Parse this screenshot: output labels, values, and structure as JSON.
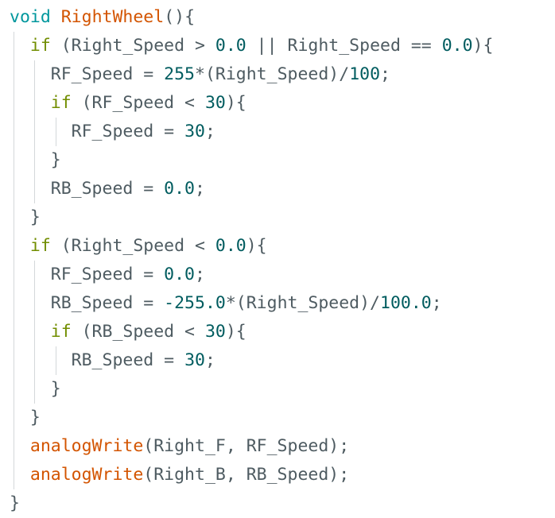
{
  "code": {
    "lines": [
      [
        {
          "t": "void",
          "c": "type"
        },
        {
          "t": " ",
          "c": "op"
        },
        {
          "t": "RightWheel",
          "c": "fn"
        },
        {
          "t": "(){",
          "c": "op"
        }
      ],
      [
        {
          "t": "  ",
          "c": "op"
        },
        {
          "t": "if",
          "c": "kw"
        },
        {
          "t": " (Right_Speed > ",
          "c": "op"
        },
        {
          "t": "0.0",
          "c": "num"
        },
        {
          "t": " || Right_Speed == ",
          "c": "op"
        },
        {
          "t": "0.0",
          "c": "num"
        },
        {
          "t": "){",
          "c": "op"
        }
      ],
      [
        {
          "t": "    RF_Speed = ",
          "c": "op"
        },
        {
          "t": "255",
          "c": "num"
        },
        {
          "t": "*(Right_Speed)/",
          "c": "op"
        },
        {
          "t": "100",
          "c": "num"
        },
        {
          "t": ";",
          "c": "op"
        }
      ],
      [
        {
          "t": "    ",
          "c": "op"
        },
        {
          "t": "if",
          "c": "kw"
        },
        {
          "t": " (RF_Speed < ",
          "c": "op"
        },
        {
          "t": "30",
          "c": "num"
        },
        {
          "t": "){",
          "c": "op"
        }
      ],
      [
        {
          "t": "      RF_Speed = ",
          "c": "op"
        },
        {
          "t": "30",
          "c": "num"
        },
        {
          "t": ";",
          "c": "op"
        }
      ],
      [
        {
          "t": "    }",
          "c": "op"
        }
      ],
      [
        {
          "t": "    RB_Speed = ",
          "c": "op"
        },
        {
          "t": "0.0",
          "c": "num"
        },
        {
          "t": ";",
          "c": "op"
        }
      ],
      [
        {
          "t": "  }",
          "c": "op"
        }
      ],
      [
        {
          "t": "  ",
          "c": "op"
        },
        {
          "t": "if",
          "c": "kw"
        },
        {
          "t": " (Right_Speed < ",
          "c": "op"
        },
        {
          "t": "0.0",
          "c": "num"
        },
        {
          "t": "){",
          "c": "op"
        }
      ],
      [
        {
          "t": "    RF_Speed = ",
          "c": "op"
        },
        {
          "t": "0.0",
          "c": "num"
        },
        {
          "t": ";",
          "c": "op"
        }
      ],
      [
        {
          "t": "    RB_Speed = ",
          "c": "op"
        },
        {
          "t": "-255.0",
          "c": "num"
        },
        {
          "t": "*(Right_Speed)/",
          "c": "op"
        },
        {
          "t": "100.0",
          "c": "num"
        },
        {
          "t": ";",
          "c": "op"
        }
      ],
      [
        {
          "t": "    ",
          "c": "op"
        },
        {
          "t": "if",
          "c": "kw"
        },
        {
          "t": " (RB_Speed < ",
          "c": "op"
        },
        {
          "t": "30",
          "c": "num"
        },
        {
          "t": "){",
          "c": "op"
        }
      ],
      [
        {
          "t": "      RB_Speed = ",
          "c": "op"
        },
        {
          "t": "30",
          "c": "num"
        },
        {
          "t": ";",
          "c": "op"
        }
      ],
      [
        {
          "t": "    }",
          "c": "op"
        }
      ],
      [
        {
          "t": "  }",
          "c": "op"
        }
      ],
      [
        {
          "t": "  ",
          "c": "op"
        },
        {
          "t": "analogWrite",
          "c": "fn"
        },
        {
          "t": "(Right_F, RF_Speed);",
          "c": "op"
        }
      ],
      [
        {
          "t": "  ",
          "c": "op"
        },
        {
          "t": "analogWrite",
          "c": "fn"
        },
        {
          "t": "(Right_B, RB_Speed);",
          "c": "op"
        }
      ],
      [
        {
          "t": "}",
          "c": "op"
        }
      ]
    ]
  },
  "colors": {
    "keyword": "#728e00",
    "type": "#00979d",
    "function": "#d35400",
    "number": "#005c5f",
    "text": "#4e5b61",
    "guide": "#d4d8da"
  }
}
